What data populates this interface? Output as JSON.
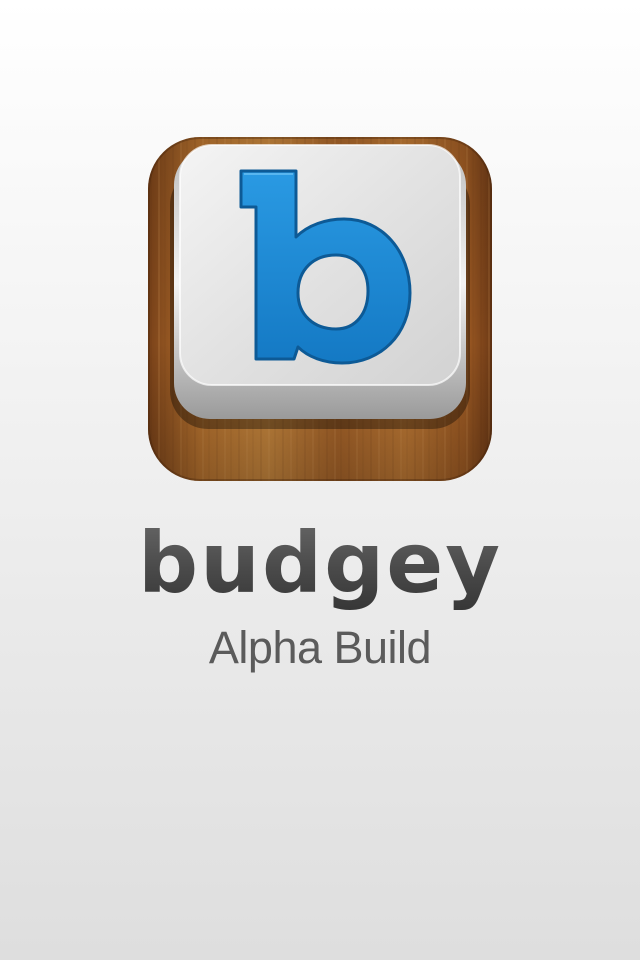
{
  "splash": {
    "app_name": "budgey",
    "subtitle": "Alpha Build",
    "icon": {
      "name": "budgey-app-icon",
      "glyph": "b",
      "glyph_color": "#1a8ad6",
      "key_color": "#e4e4e4",
      "base_material": "wood",
      "base_color": "#a0602a"
    },
    "background_top": "#ffffff",
    "background_bottom": "#dedede",
    "text_color": "#595959"
  }
}
